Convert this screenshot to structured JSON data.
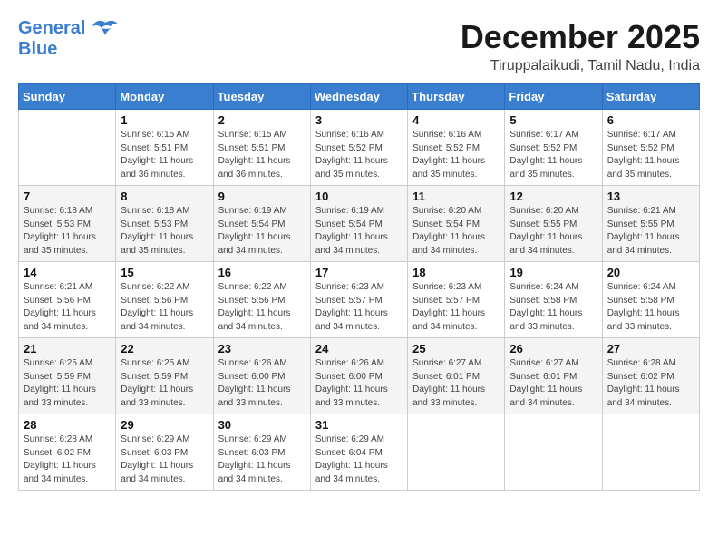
{
  "header": {
    "logo_line1": "General",
    "logo_line2": "Blue",
    "main_title": "December 2025",
    "subtitle": "Tiruppalaikudi, Tamil Nadu, India"
  },
  "calendar": {
    "days_of_week": [
      "Sunday",
      "Monday",
      "Tuesday",
      "Wednesday",
      "Thursday",
      "Friday",
      "Saturday"
    ],
    "weeks": [
      [
        {
          "day": "",
          "info": ""
        },
        {
          "day": "1",
          "info": "Sunrise: 6:15 AM\nSunset: 5:51 PM\nDaylight: 11 hours\nand 36 minutes."
        },
        {
          "day": "2",
          "info": "Sunrise: 6:15 AM\nSunset: 5:51 PM\nDaylight: 11 hours\nand 36 minutes."
        },
        {
          "day": "3",
          "info": "Sunrise: 6:16 AM\nSunset: 5:52 PM\nDaylight: 11 hours\nand 35 minutes."
        },
        {
          "day": "4",
          "info": "Sunrise: 6:16 AM\nSunset: 5:52 PM\nDaylight: 11 hours\nand 35 minutes."
        },
        {
          "day": "5",
          "info": "Sunrise: 6:17 AM\nSunset: 5:52 PM\nDaylight: 11 hours\nand 35 minutes."
        },
        {
          "day": "6",
          "info": "Sunrise: 6:17 AM\nSunset: 5:52 PM\nDaylight: 11 hours\nand 35 minutes."
        }
      ],
      [
        {
          "day": "7",
          "info": "Sunrise: 6:18 AM\nSunset: 5:53 PM\nDaylight: 11 hours\nand 35 minutes."
        },
        {
          "day": "8",
          "info": "Sunrise: 6:18 AM\nSunset: 5:53 PM\nDaylight: 11 hours\nand 35 minutes."
        },
        {
          "day": "9",
          "info": "Sunrise: 6:19 AM\nSunset: 5:54 PM\nDaylight: 11 hours\nand 34 minutes."
        },
        {
          "day": "10",
          "info": "Sunrise: 6:19 AM\nSunset: 5:54 PM\nDaylight: 11 hours\nand 34 minutes."
        },
        {
          "day": "11",
          "info": "Sunrise: 6:20 AM\nSunset: 5:54 PM\nDaylight: 11 hours\nand 34 minutes."
        },
        {
          "day": "12",
          "info": "Sunrise: 6:20 AM\nSunset: 5:55 PM\nDaylight: 11 hours\nand 34 minutes."
        },
        {
          "day": "13",
          "info": "Sunrise: 6:21 AM\nSunset: 5:55 PM\nDaylight: 11 hours\nand 34 minutes."
        }
      ],
      [
        {
          "day": "14",
          "info": "Sunrise: 6:21 AM\nSunset: 5:56 PM\nDaylight: 11 hours\nand 34 minutes."
        },
        {
          "day": "15",
          "info": "Sunrise: 6:22 AM\nSunset: 5:56 PM\nDaylight: 11 hours\nand 34 minutes."
        },
        {
          "day": "16",
          "info": "Sunrise: 6:22 AM\nSunset: 5:56 PM\nDaylight: 11 hours\nand 34 minutes."
        },
        {
          "day": "17",
          "info": "Sunrise: 6:23 AM\nSunset: 5:57 PM\nDaylight: 11 hours\nand 34 minutes."
        },
        {
          "day": "18",
          "info": "Sunrise: 6:23 AM\nSunset: 5:57 PM\nDaylight: 11 hours\nand 34 minutes."
        },
        {
          "day": "19",
          "info": "Sunrise: 6:24 AM\nSunset: 5:58 PM\nDaylight: 11 hours\nand 33 minutes."
        },
        {
          "day": "20",
          "info": "Sunrise: 6:24 AM\nSunset: 5:58 PM\nDaylight: 11 hours\nand 33 minutes."
        }
      ],
      [
        {
          "day": "21",
          "info": "Sunrise: 6:25 AM\nSunset: 5:59 PM\nDaylight: 11 hours\nand 33 minutes."
        },
        {
          "day": "22",
          "info": "Sunrise: 6:25 AM\nSunset: 5:59 PM\nDaylight: 11 hours\nand 33 minutes."
        },
        {
          "day": "23",
          "info": "Sunrise: 6:26 AM\nSunset: 6:00 PM\nDaylight: 11 hours\nand 33 minutes."
        },
        {
          "day": "24",
          "info": "Sunrise: 6:26 AM\nSunset: 6:00 PM\nDaylight: 11 hours\nand 33 minutes."
        },
        {
          "day": "25",
          "info": "Sunrise: 6:27 AM\nSunset: 6:01 PM\nDaylight: 11 hours\nand 33 minutes."
        },
        {
          "day": "26",
          "info": "Sunrise: 6:27 AM\nSunset: 6:01 PM\nDaylight: 11 hours\nand 34 minutes."
        },
        {
          "day": "27",
          "info": "Sunrise: 6:28 AM\nSunset: 6:02 PM\nDaylight: 11 hours\nand 34 minutes."
        }
      ],
      [
        {
          "day": "28",
          "info": "Sunrise: 6:28 AM\nSunset: 6:02 PM\nDaylight: 11 hours\nand 34 minutes."
        },
        {
          "day": "29",
          "info": "Sunrise: 6:29 AM\nSunset: 6:03 PM\nDaylight: 11 hours\nand 34 minutes."
        },
        {
          "day": "30",
          "info": "Sunrise: 6:29 AM\nSunset: 6:03 PM\nDaylight: 11 hours\nand 34 minutes."
        },
        {
          "day": "31",
          "info": "Sunrise: 6:29 AM\nSunset: 6:04 PM\nDaylight: 11 hours\nand 34 minutes."
        },
        {
          "day": "",
          "info": ""
        },
        {
          "day": "",
          "info": ""
        },
        {
          "day": "",
          "info": ""
        }
      ]
    ]
  }
}
